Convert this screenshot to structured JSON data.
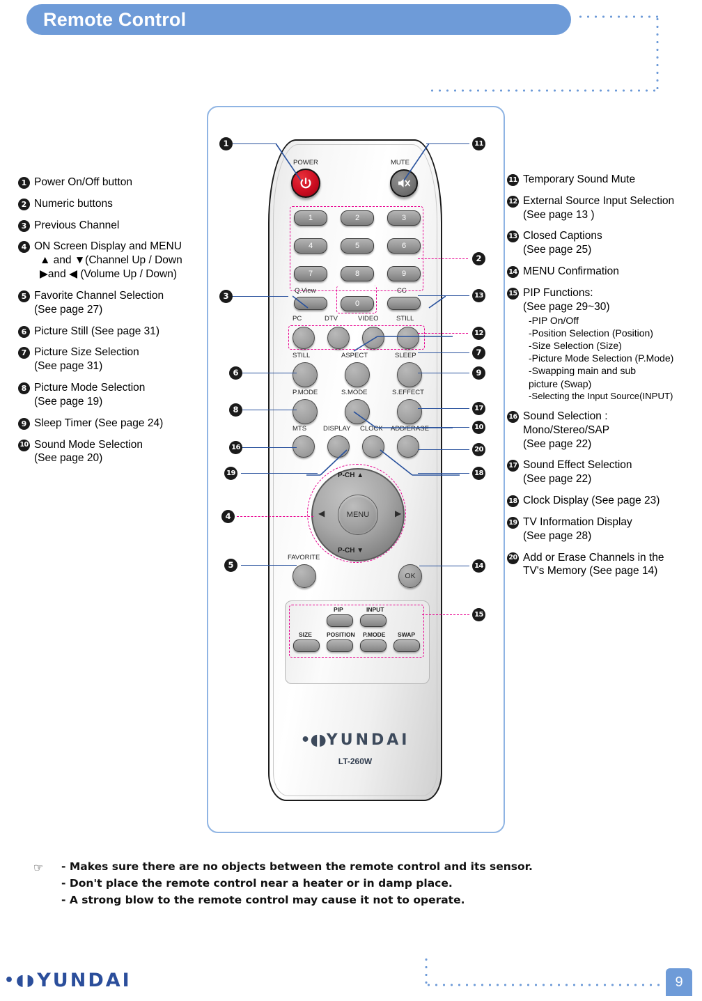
{
  "header": {
    "title": "Remote Control"
  },
  "legend_left": [
    {
      "num": "1",
      "text": "Power On/Off button"
    },
    {
      "num": "2",
      "text": "Numeric buttons"
    },
    {
      "num": "3",
      "text": "Previous Channel"
    },
    {
      "num": "4",
      "text": "ON Screen Display and MENU",
      "line_up": "▲ and ▼(Channel Up / Down",
      "line_vol": "▶and ◀ (Volume Up / Down)"
    },
    {
      "num": "5",
      "text": "Favorite Channel Selection",
      "sub": "(See page 27)"
    },
    {
      "num": "6",
      "text": "Picture Still (See page 31)"
    },
    {
      "num": "7",
      "text": "Picture Size Selection",
      "sub": "(See page 31)"
    },
    {
      "num": "8",
      "text": "Picture Mode Selection",
      "sub": "(See page 19)"
    },
    {
      "num": "9",
      "text": "Sleep Timer (See page 24)"
    },
    {
      "num": "10",
      "text": "Sound Mode Selection",
      "sub": "(See page 20)"
    }
  ],
  "legend_right": [
    {
      "num": "11",
      "text": "Temporary Sound Mute"
    },
    {
      "num": "12",
      "text": "External Source Input Selection",
      "sub": "(See page 13 )"
    },
    {
      "num": "13",
      "text": "Closed Captions",
      "sub": "(See page 25)"
    },
    {
      "num": "14",
      "text": "MENU Confirmation"
    },
    {
      "num": "15",
      "text": "PIP Functions:",
      "sub": "(See page 29~30)",
      "details": [
        "-PIP On/Off",
        "-Position Selection (Position)",
        "-Size Selection (Size)",
        "-Picture Mode Selection (P.Mode)",
        "-Swapping main and sub",
        " picture (Swap)",
        "-Selecting the Input Source(INPUT)"
      ]
    },
    {
      "num": "16",
      "text": "Sound Selection :",
      "sub": "Mono/Stereo/SAP",
      "sub2": "(See page 22)"
    },
    {
      "num": "17",
      "text": "Sound Effect Selection",
      "sub": "(See page 22)"
    },
    {
      "num": "18",
      "text": "Clock Display (See page 23)"
    },
    {
      "num": "19",
      "text": "TV Information Display",
      "sub": "(See page 28)"
    },
    {
      "num": "20",
      "text": "Add or Erase Channels in the",
      "sub": "TV's Memory (See page 14)"
    }
  ],
  "remote": {
    "power_label": "POWER",
    "mute_label": "MUTE",
    "numbers": [
      "1",
      "2",
      "3",
      "4",
      "5",
      "6",
      "7",
      "8",
      "9",
      "0"
    ],
    "qview_label": "Q.View",
    "cc_label": "CC",
    "row_pc": [
      "PC",
      "DTV",
      "VIDEO",
      "STILL"
    ],
    "row_still": [
      "STILL",
      "ASPECT",
      "SLEEP"
    ],
    "row_pmode": [
      "P.MODE",
      "S.MODE",
      "S.EFFECT"
    ],
    "row_mts": [
      "MTS",
      "DISPLAY",
      "CLOCK",
      "ADD/ERASE"
    ],
    "nav_up": "P-CH",
    "nav_down": "P-CH",
    "nav_menu": "MENU",
    "favorite_label": "FAVORITE",
    "ok_label": "OK",
    "pip_top": [
      "PIP",
      "INPUT"
    ],
    "pip_bottom": [
      "SIZE",
      "POSITION",
      "P.MODE",
      "SWAP"
    ],
    "brand": "YUNDAI",
    "model": "LT-260W"
  },
  "markers_left": [
    "1",
    "3",
    "6",
    "8",
    "16",
    "19",
    "4",
    "5"
  ],
  "markers_right": [
    "11",
    "2",
    "13",
    "12",
    "7",
    "9",
    "17",
    "10",
    "20",
    "18",
    "14",
    "15"
  ],
  "notes": {
    "hand_icon": "☞",
    "lines": [
      "- Makes sure there are no objects between the remote control and its sensor.",
      "- Don't place the remote control near a heater or in damp place.",
      "- A strong blow to the remote control may cause it not to operate."
    ]
  },
  "footer": {
    "logo_text": "YUNDAI",
    "page_number": "9"
  }
}
